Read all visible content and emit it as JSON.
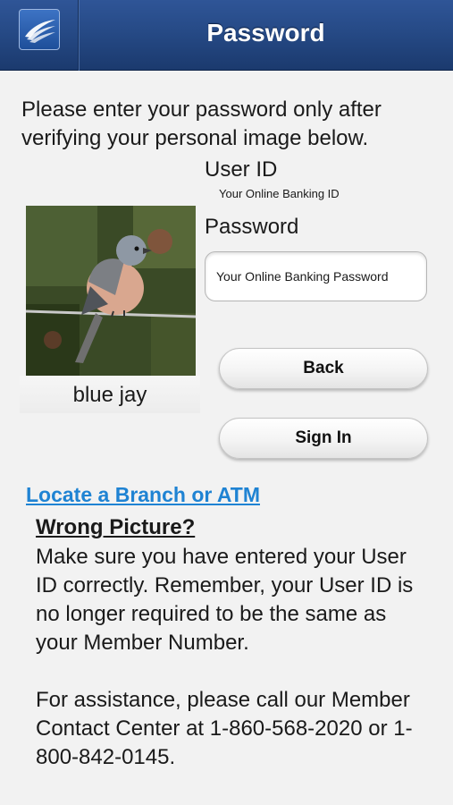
{
  "header": {
    "title": "Password",
    "logo_icon": "swoosh-logo-icon",
    "bar_color": "#264a86"
  },
  "intro_text": "Please enter your password only after verifying your personal image below.",
  "user_id": {
    "label": "User ID",
    "value": "Your Online Banking ID"
  },
  "password": {
    "label": "Password",
    "placeholder": "Your Online Banking Password"
  },
  "personal_image": {
    "caption": "blue jay"
  },
  "buttons": {
    "back": "Back",
    "sign_in": "Sign In"
  },
  "locate_link": "Locate a Branch or ATM",
  "wrong_picture": {
    "heading": "Wrong Picture?",
    "paragraph1": "Make sure you have entered your User ID correctly.  Remember, your User ID is no longer required to be the same as your Member Number.",
    "paragraph2": "For assistance, please call our Member Contact Center at 1-860-568-2020 or 1-800-842-0145."
  },
  "colors": {
    "link": "#1f83d3",
    "background": "#f2f2f2"
  }
}
